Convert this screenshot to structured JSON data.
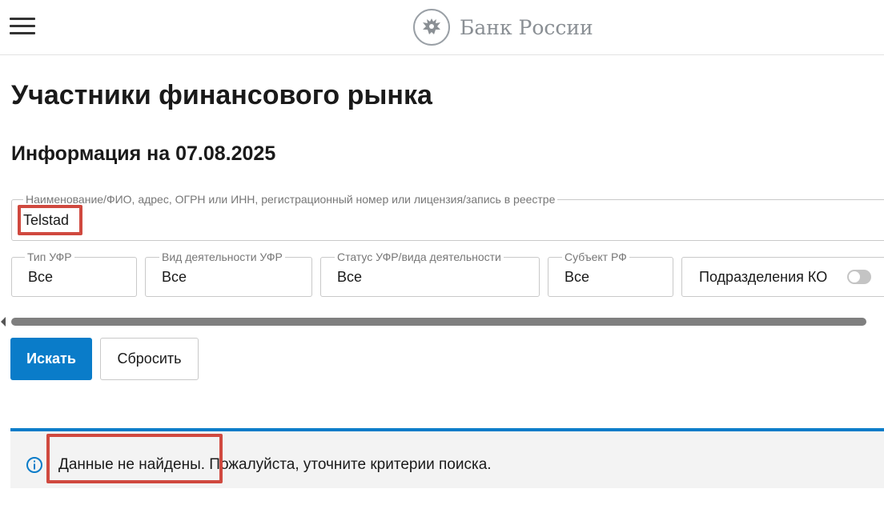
{
  "header": {
    "menu_icon": "hamburger-menu-icon",
    "logo_text": "Банк России",
    "logo_icon": "double-headed-eagle-emblem-icon"
  },
  "page": {
    "title": "Участники финансового рынка",
    "info_date": "Информация на 07.08.2025"
  },
  "search": {
    "label": "Наименование/ФИО, адрес, ОГРН или ИНН, регистрационный номер или лицензия/запись в реестре",
    "value": "Telstad"
  },
  "filters": [
    {
      "label": "Тип УФР",
      "value": "Все"
    },
    {
      "label": "Вид деятельности УФР",
      "value": "Все"
    },
    {
      "label": "Статус УФР/вида деятельности",
      "value": "Все"
    },
    {
      "label": "Субъект РФ",
      "value": "Все"
    }
  ],
  "toggle": {
    "label": "Подразделения КО",
    "checked": false
  },
  "buttons": {
    "search": "Искать",
    "reset": "Сбросить"
  },
  "alert": {
    "icon": "info-circle-icon",
    "message": "Данные не найдены. Пожалуйста, уточните критерии поиска."
  },
  "colors": {
    "accent": "#0a7cc9",
    "highlight": "#d0493f",
    "alert_bg": "#f3f3f3"
  }
}
